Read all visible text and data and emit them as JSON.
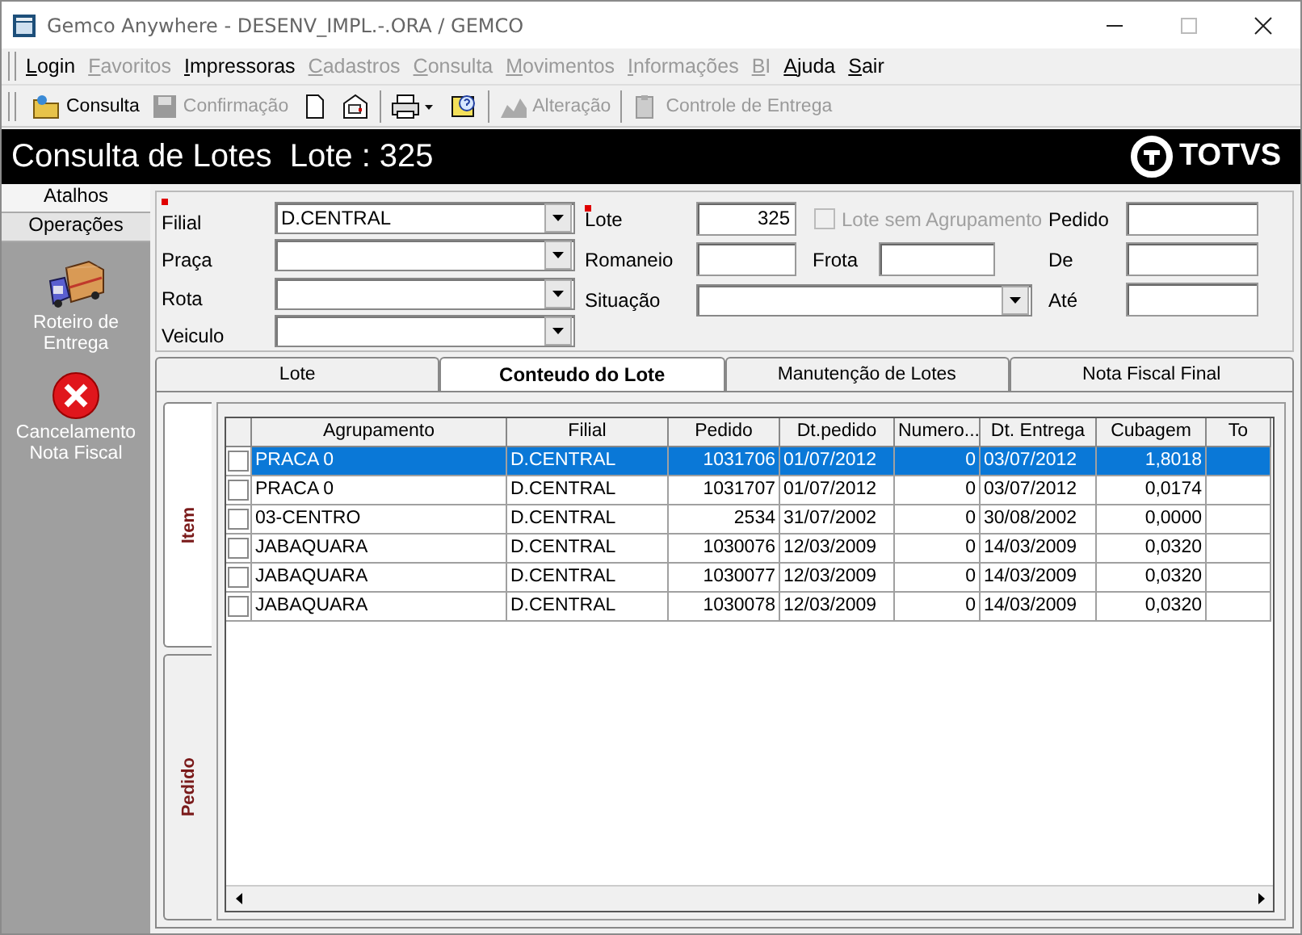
{
  "window": {
    "title": "Gemco Anywhere - DESENV_IMPL.-.ORA / GEMCO"
  },
  "menu": [
    {
      "label": "Login",
      "disabled": false
    },
    {
      "label": "Favoritos",
      "disabled": true
    },
    {
      "label": "Impressoras",
      "disabled": false
    },
    {
      "label": "Cadastros",
      "disabled": true
    },
    {
      "label": "Consulta",
      "disabled": true
    },
    {
      "label": "Movimentos",
      "disabled": true
    },
    {
      "label": "Informações",
      "disabled": true
    },
    {
      "label": "BI",
      "disabled": true
    },
    {
      "label": "Ajuda",
      "disabled": false
    },
    {
      "label": "Sair",
      "disabled": false
    }
  ],
  "toolbar": [
    {
      "kind": "labeled",
      "label": "Consulta",
      "disabled": false
    },
    {
      "kind": "labeled",
      "label": "Confirmação",
      "disabled": true
    },
    {
      "kind": "icon"
    },
    {
      "kind": "icon"
    },
    {
      "kind": "separator"
    },
    {
      "kind": "icon"
    },
    {
      "kind": "icon"
    },
    {
      "kind": "separator"
    },
    {
      "kind": "labeled",
      "label": "Alteração",
      "disabled": true
    },
    {
      "kind": "separator"
    },
    {
      "kind": "labeled",
      "label": "Controle de Entrega",
      "disabled": true
    }
  ],
  "header": {
    "title": "Consulta de Lotes  Lote : 325",
    "brand": "TOTVS"
  },
  "sidebar": {
    "tabs": [
      {
        "label": "Atalhos",
        "selected": false
      },
      {
        "label": "Operações",
        "selected": true
      }
    ],
    "items": [
      {
        "label": "Roteiro de Entrega"
      },
      {
        "label": "Cancelamento Nota Fiscal"
      }
    ]
  },
  "form": {
    "filial": {
      "label": "Filial",
      "value": "D.CENTRAL",
      "required": true
    },
    "praca": {
      "label": "Praça"
    },
    "rota": {
      "label": "Rota"
    },
    "veiculo": {
      "label": "Veiculo"
    },
    "lote": {
      "label": "Lote",
      "value": "325",
      "required": true
    },
    "lote_sem_agrupamento": {
      "label": "Lote sem Agrupamento",
      "checked": false,
      "disabled": true
    },
    "romaneio": {
      "label": "Romaneio"
    },
    "frota": {
      "label": "Frota"
    },
    "situacao": {
      "label": "Situação"
    },
    "pedido": {
      "label": "Pedido"
    },
    "de": {
      "label": "De"
    },
    "ate": {
      "label": "Até"
    }
  },
  "tabs": [
    {
      "label": "Lote",
      "selected": false
    },
    {
      "label": "Conteudo do Lote",
      "selected": true
    },
    {
      "label": "Manutenção de Lotes",
      "selected": false
    },
    {
      "label": "Nota Fiscal Final",
      "selected": false
    }
  ],
  "side_tabs": [
    {
      "label": "Item",
      "selected": true
    },
    {
      "label": "Pedido",
      "selected": false
    }
  ],
  "table": {
    "columns": [
      {
        "label": "Agrupamento"
      },
      {
        "label": "Filial"
      },
      {
        "label": "Pedido"
      },
      {
        "label": "Dt.pedido"
      },
      {
        "label": "Numero..."
      },
      {
        "label": "Dt. Entrega"
      },
      {
        "label": "Cubagem"
      },
      {
        "label": "To"
      }
    ],
    "rows": [
      {
        "checked": false,
        "selected": true,
        "cells": [
          "PRACA 0",
          "D.CENTRAL",
          "1031706",
          "01/07/2012",
          "0",
          "03/07/2012",
          "1,8018"
        ]
      },
      {
        "checked": false,
        "selected": false,
        "cells": [
          "PRACA 0",
          "D.CENTRAL",
          "1031707",
          "01/07/2012",
          "0",
          "03/07/2012",
          "0,0174"
        ]
      },
      {
        "checked": false,
        "selected": false,
        "cells": [
          "03-CENTRO",
          "D.CENTRAL",
          "2534",
          "31/07/2002",
          "0",
          "30/08/2002",
          "0,0000"
        ]
      },
      {
        "checked": false,
        "selected": false,
        "cells": [
          "JABAQUARA",
          "D.CENTRAL",
          "1030076",
          "12/03/2009",
          "0",
          "14/03/2009",
          "0,0320"
        ]
      },
      {
        "checked": false,
        "selected": false,
        "cells": [
          "JABAQUARA",
          "D.CENTRAL",
          "1030077",
          "12/03/2009",
          "0",
          "14/03/2009",
          "0,0320"
        ]
      },
      {
        "checked": false,
        "selected": false,
        "cells": [
          "JABAQUARA",
          "D.CENTRAL",
          "1030078",
          "12/03/2009",
          "0",
          "14/03/2009",
          "0,0320"
        ]
      }
    ]
  }
}
